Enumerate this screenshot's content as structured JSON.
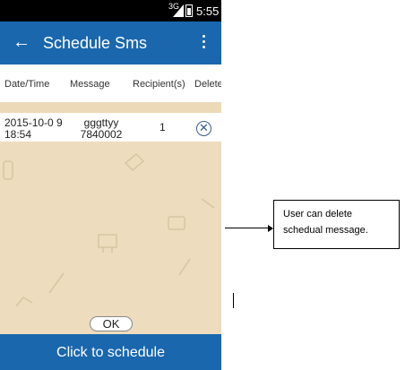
{
  "status_bar": {
    "network": "3G",
    "time": "5:55"
  },
  "app_bar": {
    "title": "Schedule Sms",
    "back_icon": "←"
  },
  "table": {
    "headers": [
      "Date/Time",
      "Message",
      "Recipient(s)",
      "Delete"
    ],
    "rows": [
      {
        "datetime": "2015-10-0 9 18:54",
        "message": "gggttyy 7840002",
        "recipients": "1",
        "delete_icon": "ⓧ"
      }
    ]
  },
  "ok_label": "OK",
  "schedule_label": "Click to schedule",
  "annotation": {
    "text": "User can delete schedual message."
  }
}
